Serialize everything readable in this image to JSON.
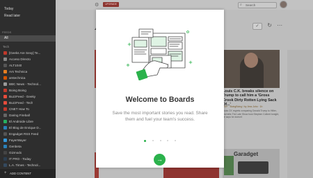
{
  "sidebar": {
    "top_links": [
      "Today",
      "Read later"
    ],
    "section_label": "FEEDS",
    "all_label": "All",
    "group_label": "Tech",
    "feeds": [
      {
        "label": "[Geeks Are Sexy] Te...",
        "count": "",
        "color": "#c0392b"
      },
      {
        "label": "Acceso Directo",
        "count": "",
        "color": "#888888"
      },
      {
        "label": "ALT1040",
        "count": "",
        "color": "#555555"
      },
      {
        "label": "Ars Technica",
        "count": "",
        "color": "#e67e22"
      },
      {
        "label": "arstechnica",
        "count": "",
        "color": "#d35400"
      },
      {
        "label": "BBC News - Technol...",
        "count": "",
        "color": "#999999"
      },
      {
        "label": "Boing Boing",
        "count": "",
        "color": "#c0392b"
      },
      {
        "label": "BuzzFeed - Geeky",
        "count": "",
        "color": "#e74c3c"
      },
      {
        "label": "BuzzFeed - Tech",
        "count": "",
        "color": "#e74c3c"
      },
      {
        "label": "CNET How To",
        "count": "",
        "color": "#c0392b"
      },
      {
        "label": "Daring Fireball",
        "count": "",
        "color": "#666666"
      },
      {
        "label": "El Androide Libre",
        "count": "",
        "color": "#27ae60"
      },
      {
        "label": "El Blog de Enrique D...",
        "count": "",
        "color": "#2980b9"
      },
      {
        "label": "Engadget RSS Feed",
        "count": "",
        "color": "#555555"
      },
      {
        "label": "FayerWayer",
        "count": "",
        "color": "#3498db"
      },
      {
        "label": "Genbeta",
        "count": "",
        "color": "#2980b9"
      },
      {
        "label": "Gizmodo",
        "count": "",
        "color": "#444444"
      },
      {
        "label": "IT PRO - Today",
        "count": "",
        "color": "#2c3e50"
      },
      {
        "label": "L.A. Times - Technol...",
        "count": "",
        "color": "#34495e"
      }
    ],
    "add_content": "ADD CONTENT"
  },
  "header": {
    "upgrade_label": "UPGRADE",
    "search_placeholder": "Search",
    "page_initial": "A"
  },
  "article": {
    "title": "Louis C.K. breaks silence on Trump to call him a 'Gross Crook Dirty Rotten Lying Sack Of...'",
    "meta": "100+ · BoingBoing / by Jess Joho · 1h",
    "snippet": "Louis CK regrets comparing Donald Trump to Hitler, and tells The Late Show host Stephen Colbert tonight, he says he doesn't",
    "garadget_label": "Garadget"
  },
  "modal": {
    "title": "Welcome to Boards",
    "subtitle": "Save the most important stories you read. Share them and fuel your team's success.",
    "dots_total": 5,
    "dots_active": 1,
    "accent": "#2bb24c",
    "next_icon": "arrow-right-icon"
  }
}
